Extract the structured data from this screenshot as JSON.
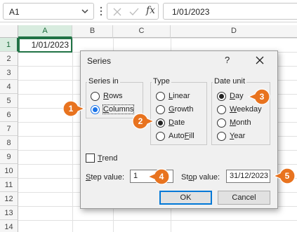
{
  "formula_bar": {
    "name_box": "A1",
    "fx_label": "fx",
    "formula": "1/01/2023"
  },
  "grid": {
    "columns": [
      "A",
      "B",
      "C",
      "D"
    ],
    "rows": [
      "1",
      "2",
      "3",
      "4",
      "5",
      "6",
      "7",
      "8",
      "9",
      "10",
      "11",
      "12",
      "13",
      "14"
    ],
    "cell_a1": "1/01/2023"
  },
  "dialog": {
    "title": "Series",
    "help": "?",
    "series_in": {
      "label": "Series in",
      "options": [
        {
          "pre": "",
          "u": "R",
          "post": "ows",
          "selected": false
        },
        {
          "pre": "",
          "u": "C",
          "post": "olumns",
          "selected": true
        }
      ]
    },
    "type": {
      "label": "Type",
      "options": [
        {
          "pre": "",
          "u": "L",
          "post": "inear",
          "selected": false
        },
        {
          "pre": "",
          "u": "G",
          "post": "rowth",
          "selected": false
        },
        {
          "pre": "",
          "u": "D",
          "post": "ate",
          "selected": true
        },
        {
          "pre": "Auto",
          "u": "F",
          "post": "ill",
          "selected": false
        }
      ]
    },
    "date_unit": {
      "label": "Date unit",
      "options": [
        {
          "pre": "",
          "u": "D",
          "post": "ay",
          "selected": true
        },
        {
          "pre": "",
          "u": "W",
          "post": "eekday",
          "selected": false
        },
        {
          "pre": "",
          "u": "M",
          "post": "onth",
          "selected": false
        },
        {
          "pre": "",
          "u": "Y",
          "post": "ear",
          "selected": false
        }
      ]
    },
    "trend": {
      "u": "T",
      "post": "rend",
      "checked": false
    },
    "step_value": {
      "u": "S",
      "post": "tep value:",
      "value": "1"
    },
    "stop_value": {
      "pre": "St",
      "u": "o",
      "post": "p value:",
      "value": "31/12/2023"
    },
    "ok_label": "OK",
    "cancel_label": "Cancel"
  },
  "callouts": [
    "1",
    "2",
    "3",
    "4",
    "5"
  ],
  "colors": {
    "accent_green": "#217346",
    "callout_orange": "#e8731f",
    "focus_blue": "#1a73e8"
  }
}
